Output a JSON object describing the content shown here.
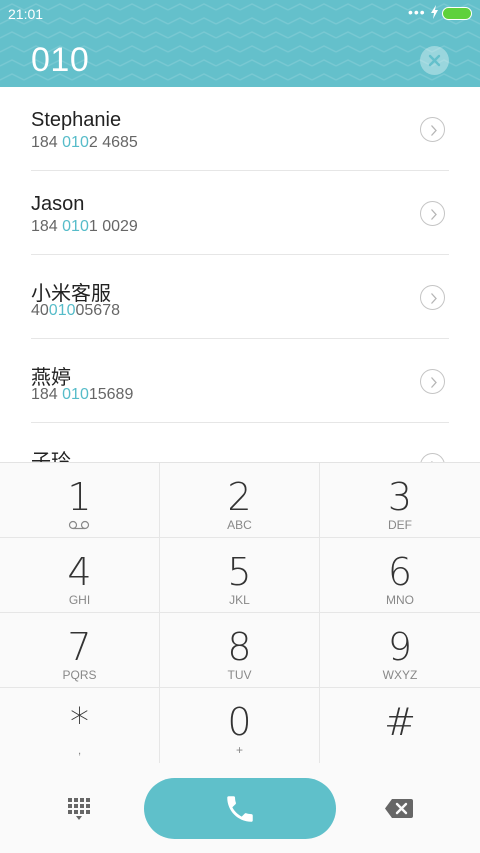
{
  "status_bar": {
    "time": "21:01",
    "more_dots": "•••"
  },
  "dialer": {
    "input_value": "010"
  },
  "contacts": [
    {
      "name": "Stephanie",
      "number_prefix": "184 ",
      "number_match": "010",
      "number_suffix": "2 4685"
    },
    {
      "name": "Jason",
      "number_prefix": "184 ",
      "number_match": "010",
      "number_suffix": "1 0029"
    },
    {
      "name": "小米客服",
      "number_prefix": "40",
      "number_match": "010",
      "number_suffix": "05678"
    },
    {
      "name": "燕婷",
      "number_prefix": "184 ",
      "number_match": "010",
      "number_suffix": "15689"
    },
    {
      "name": "子玲",
      "number_prefix": "",
      "number_match": "",
      "number_suffix": ""
    }
  ],
  "keypad": {
    "keys": [
      {
        "digit": "1",
        "letters": ""
      },
      {
        "digit": "2",
        "letters": "ABC"
      },
      {
        "digit": "3",
        "letters": "DEF"
      },
      {
        "digit": "4",
        "letters": "GHI"
      },
      {
        "digit": "5",
        "letters": "JKL"
      },
      {
        "digit": "6",
        "letters": "MNO"
      },
      {
        "digit": "7",
        "letters": "PQRS"
      },
      {
        "digit": "8",
        "letters": "TUV"
      },
      {
        "digit": "9",
        "letters": "WXYZ"
      },
      {
        "digit": "*",
        "letters": ","
      },
      {
        "digit": "0",
        "letters": "+"
      },
      {
        "digit": "#",
        "letters": ""
      }
    ]
  },
  "colors": {
    "accent": "#5fc0ca",
    "highlight": "#56bcc9",
    "header": "#64c0cb",
    "battery": "#5fd13c"
  },
  "icons": {
    "voicemail": "voicemail-icon",
    "clear": "clear-input-icon",
    "contact_detail": "chevron-right-circle-icon",
    "dialpad": "dialpad-grid-icon",
    "call": "phone-icon",
    "delete": "backspace-icon"
  }
}
